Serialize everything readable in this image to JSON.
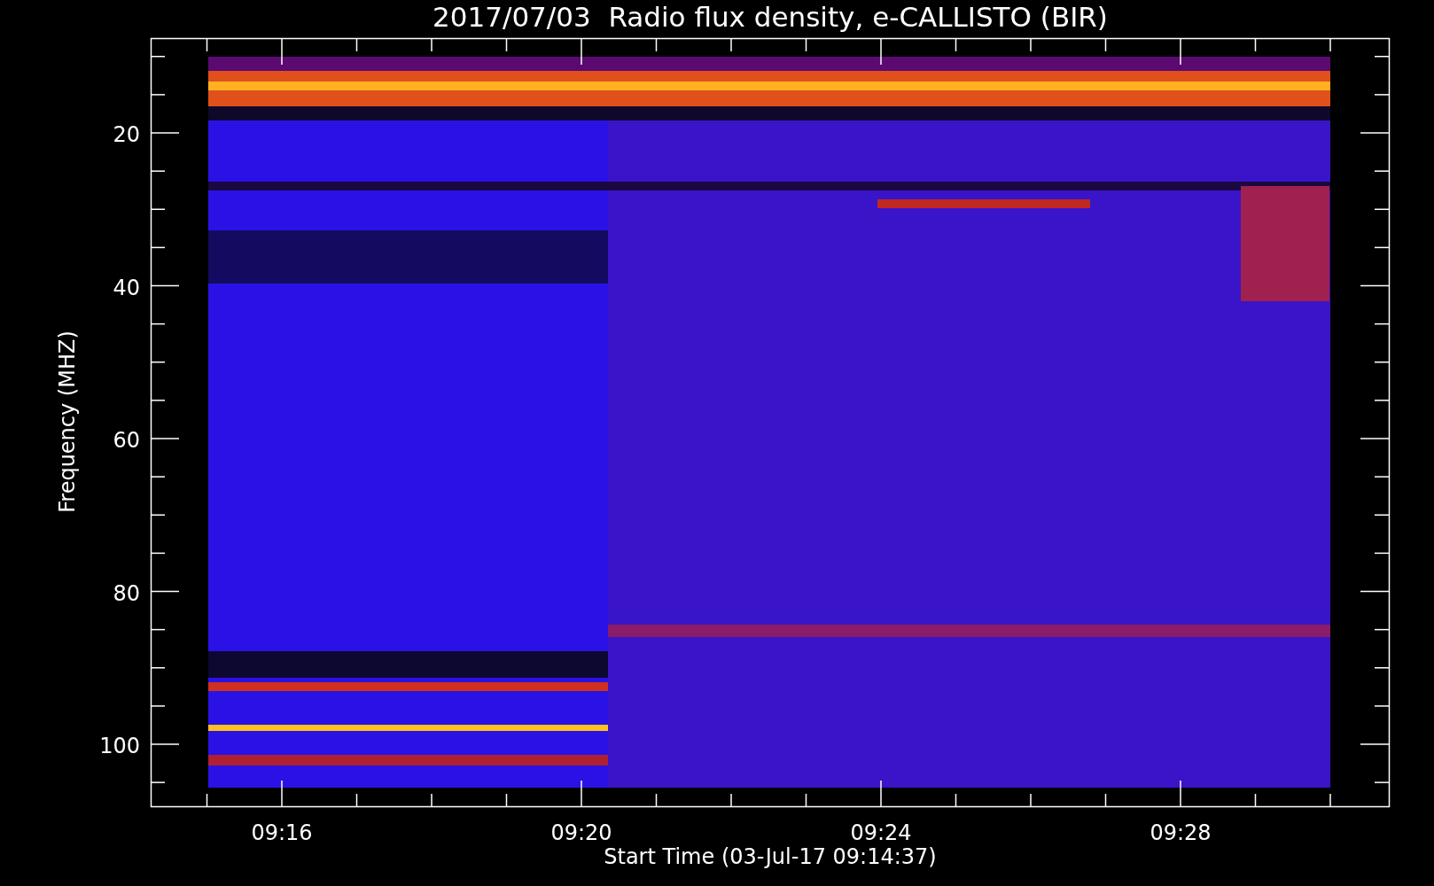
{
  "title": "2017/07/03  Radio flux density, e-CALLISTO (BIR)",
  "y_axis": {
    "label": "Frequency (MHZ)",
    "ticks": [
      "20",
      "40",
      "60",
      "80",
      "100"
    ]
  },
  "x_axis": {
    "label": "Start Time (03-Jul-17 09:14:37)",
    "ticks": [
      "09:16",
      "09:20",
      "09:24",
      "09:28"
    ]
  }
}
